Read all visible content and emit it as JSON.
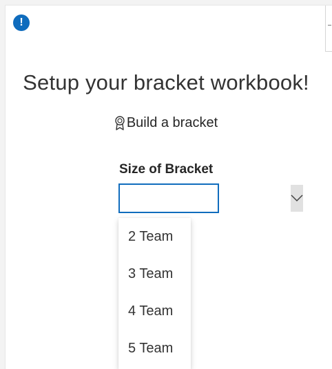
{
  "notification": {
    "icon": "info-icon",
    "glyph": "!"
  },
  "page": {
    "title": "Setup your bracket workbook!",
    "build_link": {
      "icon": "ribbon-award-icon",
      "label": "Build a bracket"
    }
  },
  "bracket_size": {
    "label": "Size of Bracket",
    "value": "",
    "dropdown_icon": "chevron-down-icon",
    "options": [
      "2 Team",
      "3 Team",
      "4 Team",
      "5 Team"
    ]
  },
  "colors": {
    "accent": "#0f6cbd",
    "dropdown_button_bg": "#e1e1e1",
    "text": "#333333"
  }
}
